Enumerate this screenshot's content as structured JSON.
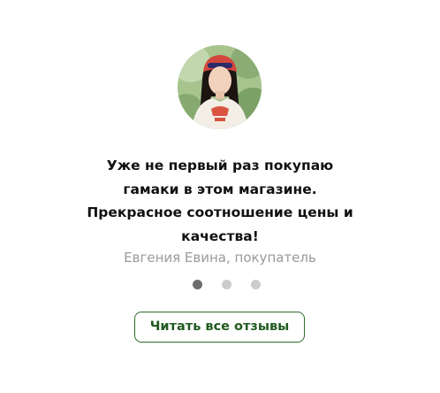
{
  "review": {
    "lines": [
      "Уже не первый раз покупаю",
      "гамаки в этом магазине.",
      "Прекрасное соотношение цены и",
      "качества!"
    ],
    "author": "Евгения Евина, покупатель"
  },
  "carousel": {
    "slide_count": 3,
    "active_index": 0
  },
  "actions": {
    "read_all_label": "Читать все отзывы"
  },
  "colors": {
    "accent": "#2f6b2b",
    "dot_active": "#6e6e6e",
    "dot_inactive": "#cccccc",
    "author_text": "#9a9a9a"
  },
  "icons": {
    "avatar": "reviewer-photo"
  }
}
